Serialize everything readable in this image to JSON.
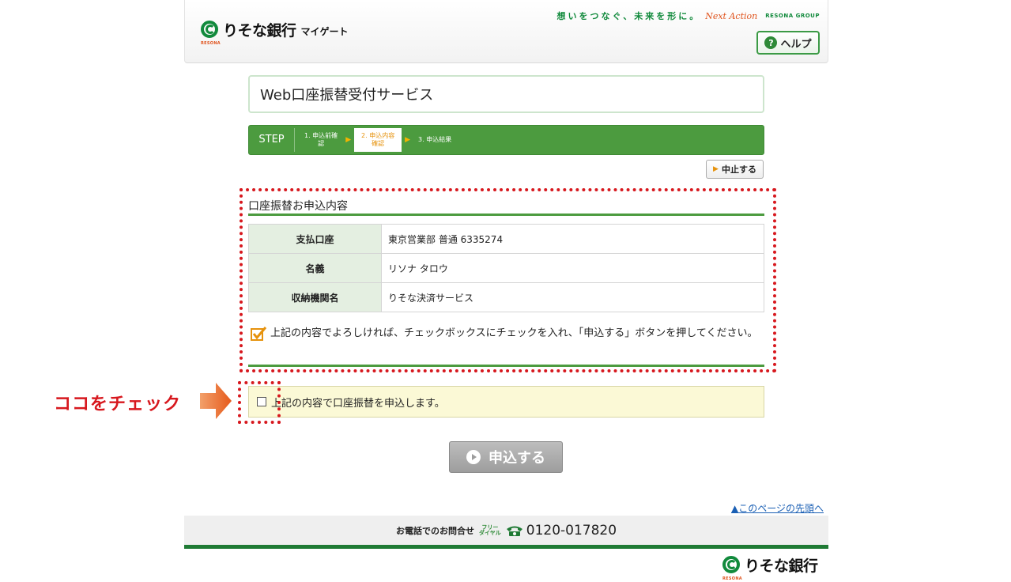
{
  "header": {
    "logo_text": "りそな銀行",
    "logo_sub": "マイゲート",
    "logo_mark_sub": "RESONA",
    "slogan_jp": "想いをつなぐ、未来を形に。",
    "slogan_en": "Next Action",
    "slogan_group": "RESONA GROUP",
    "help_label": "ヘルプ",
    "help_icon_glyph": "?"
  },
  "page": {
    "title": "Web口座振替受付サービス"
  },
  "steps": {
    "label": "STEP",
    "items": [
      {
        "line1": "1. 申込前確",
        "line2": "認"
      },
      {
        "line1": "2. 申込内容",
        "line2": "確認"
      },
      {
        "line1": "3. 申込結果",
        "line2": ""
      }
    ],
    "arrow_glyph": "▶"
  },
  "cancel": {
    "label": "中止する",
    "glyph": "▶"
  },
  "section": {
    "title": "口座振替お申込内容",
    "rows": [
      {
        "label": "支払口座",
        "value": "東京営業部 普通 6335274"
      },
      {
        "label": "名義",
        "value": "リソナ タロウ"
      },
      {
        "label": "収納機関名",
        "value": "りそな決済サービス"
      }
    ],
    "note": "上記の内容でよろしければ、チェックボックスにチェックを入れ、「申込する」ボタンを押してください。"
  },
  "agree": {
    "label": "上記の内容で口座振替を申込します。",
    "checked": false
  },
  "callout": {
    "text": "ココをチェック"
  },
  "submit": {
    "label": "申込する"
  },
  "top_link": "▲このページの先頭へ",
  "footer": {
    "label": "お電話でのお問合せ",
    "free_dial_1": "フリー",
    "free_dial_2": "ダイヤル",
    "phone": "0120-017820",
    "logo_text": "りそな銀行",
    "logo_mark_sub": "RESONA"
  },
  "colors": {
    "brand_green": "#4c9b3f",
    "accent_orange": "#e6920c",
    "alert_red": "#d7181e"
  }
}
